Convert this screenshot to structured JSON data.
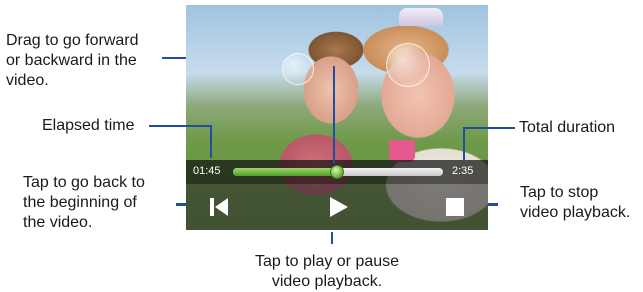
{
  "callouts": {
    "seek": "Drag to go forward\nor backward in the\nvideo.",
    "elapsed": "Elapsed time",
    "total": "Total duration",
    "back": "Tap to go back to\nthe beginning of\nthe video.",
    "stop": "Tap to stop\nvideo playback.",
    "play": "Tap to play or pause\nvideo playback."
  },
  "player": {
    "elapsed_time": "01:45",
    "total_duration": "2:35",
    "progress_fraction": 0.49
  },
  "icons": {
    "back": "skip-to-start-icon",
    "play": "play-icon",
    "stop": "stop-icon"
  },
  "colors": {
    "callout_line": "#1f4f9e",
    "progress_fill": "#5fae2f"
  }
}
